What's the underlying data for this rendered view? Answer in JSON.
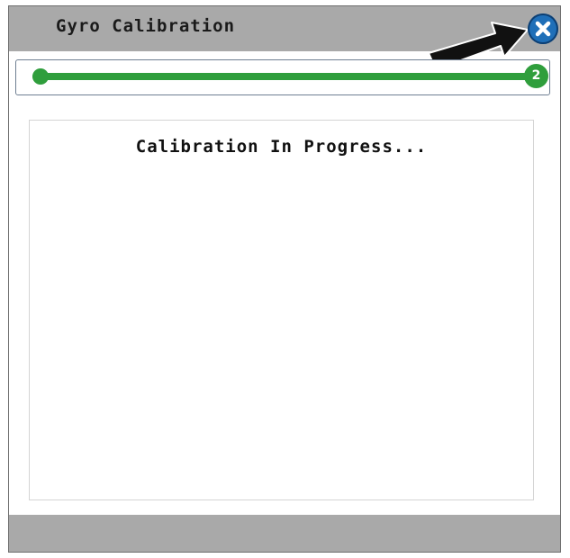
{
  "window": {
    "title": "Gyro Calibration",
    "close_icon": "close-icon"
  },
  "progress": {
    "current_step": "2",
    "fraction_complete": 1.0,
    "color": "#2f9e3c"
  },
  "content": {
    "status_text": "Calibration In Progress..."
  },
  "annotation": {
    "icon": "arrow-pointer-icon"
  },
  "colors": {
    "titlebar": "#a9a9a9",
    "close_button": "#1f6fb8",
    "footer": "#a9a9a9"
  }
}
